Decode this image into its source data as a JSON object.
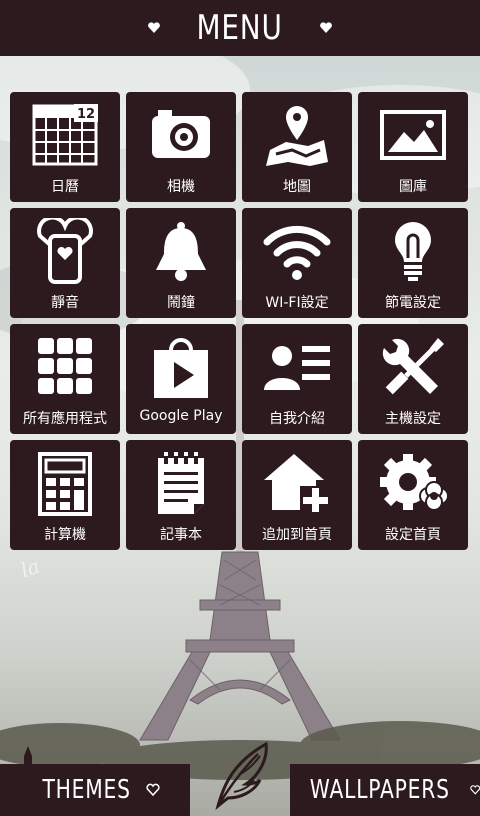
{
  "header": {
    "title": "MENU"
  },
  "tiles": [
    {
      "label": "日曆",
      "icon": "calendar-icon",
      "badge": "12"
    },
    {
      "label": "相機",
      "icon": "camera-icon"
    },
    {
      "label": "地圖",
      "icon": "map-icon"
    },
    {
      "label": "圖庫",
      "icon": "gallery-icon"
    },
    {
      "label": "靜音",
      "icon": "silent-phone-icon"
    },
    {
      "label": "鬧鐘",
      "icon": "bell-icon"
    },
    {
      "label": "WI-FI設定",
      "icon": "wifi-icon"
    },
    {
      "label": "節電設定",
      "icon": "bulb-icon"
    },
    {
      "label": "所有應用程式",
      "icon": "all-apps-icon"
    },
    {
      "label": "Google Play",
      "icon": "play-store-icon"
    },
    {
      "label": "自我介紹",
      "icon": "profile-icon"
    },
    {
      "label": "主機設定",
      "icon": "tools-icon"
    },
    {
      "label": "計算機",
      "icon": "calculator-icon"
    },
    {
      "label": "記事本",
      "icon": "notepad-icon"
    },
    {
      "label": "追加到首頁",
      "icon": "add-home-icon"
    },
    {
      "label": "設定首頁",
      "icon": "home-settings-icon"
    }
  ],
  "bottom": {
    "themes_label": "THEMES",
    "wallpapers_label": "WALLPAPERS"
  },
  "colors": {
    "tile_bg": "#2c1a1e",
    "header_bg": "#2c1a1e",
    "icon": "#ffffff"
  }
}
